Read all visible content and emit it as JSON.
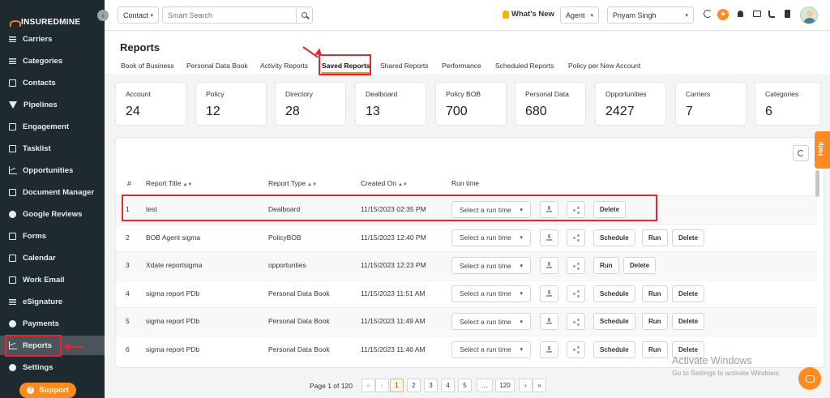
{
  "brand": {
    "name": "INSUREDMINE",
    "accent": "#ff8a1f",
    "highlight": "#e3262f"
  },
  "sidebar": {
    "items": [
      {
        "label": "Carriers",
        "icon": "carrier-icon"
      },
      {
        "label": "Categories",
        "icon": "list-icon"
      },
      {
        "label": "Contacts",
        "icon": "contacts-icon"
      },
      {
        "label": "Pipelines",
        "icon": "filter-icon"
      },
      {
        "label": "Engagement",
        "icon": "megaphone-icon"
      },
      {
        "label": "Tasklist",
        "icon": "tasklist-icon"
      },
      {
        "label": "Opportunities",
        "icon": "bar-chart-icon"
      },
      {
        "label": "Document Manager",
        "icon": "folder-icon"
      },
      {
        "label": "Google Reviews",
        "icon": "google-icon"
      },
      {
        "label": "Forms",
        "icon": "forms-icon"
      },
      {
        "label": "Calendar",
        "icon": "calendar-icon"
      },
      {
        "label": "Work Email",
        "icon": "email-icon"
      },
      {
        "label": "eSignature",
        "icon": "signature-icon"
      },
      {
        "label": "Payments",
        "icon": "dollar-icon"
      },
      {
        "label": "Reports",
        "icon": "line-chart-icon",
        "active": true
      },
      {
        "label": "Settings",
        "icon": "gear-icon"
      }
    ],
    "support_label": "Support"
  },
  "topbar": {
    "search_scope": "Contact",
    "search_placeholder": "Smart Search",
    "whats_new": "What's New",
    "role": "Agent",
    "user": "Priyam Singh"
  },
  "page": {
    "title": "Reports",
    "tabs": [
      {
        "label": "Book of Business"
      },
      {
        "label": "Personal Data Book"
      },
      {
        "label": "Activity Reports"
      },
      {
        "label": "Saved Reports",
        "active": true
      },
      {
        "label": "Shared Reports"
      },
      {
        "label": "Performance"
      },
      {
        "label": "Scheduled Reports"
      },
      {
        "label": "Policy per New Account"
      }
    ]
  },
  "stats": [
    {
      "label": "Account",
      "value": "24"
    },
    {
      "label": "Policy",
      "value": "12"
    },
    {
      "label": "Directory",
      "value": "28"
    },
    {
      "label": "Dealboard",
      "value": "13"
    },
    {
      "label": "Policy BOB",
      "value": "700"
    },
    {
      "label": "Personal Data",
      "value": "680"
    },
    {
      "label": "Opportunities",
      "value": "2427"
    },
    {
      "label": "Carriers",
      "value": "7"
    },
    {
      "label": "Categories",
      "value": "6"
    }
  ],
  "table": {
    "headers": {
      "num": "#",
      "title": "Report Title",
      "type": "Report Type",
      "created": "Created On",
      "run": "Run time"
    },
    "run_placeholder": "Select a run time",
    "rows": [
      {
        "num": "1",
        "title": "test",
        "type": "Dealboard",
        "created": "11/15/2023 02:35 PM",
        "actions": [
          "Delete"
        ]
      },
      {
        "num": "2",
        "title": "BOB Agent sigma",
        "type": "PolicyBOB",
        "created": "11/15/2023 12:40 PM",
        "actions": [
          "Schedule",
          "Run",
          "Delete"
        ]
      },
      {
        "num": "3",
        "title": "Xdate reportsigma",
        "type": "opportunties",
        "created": "11/15/2023 12:23 PM",
        "actions": [
          "Run",
          "Delete"
        ]
      },
      {
        "num": "4",
        "title": "sigma report PDb",
        "type": "Personal Data Book",
        "created": "11/15/2023 11:51 AM",
        "actions": [
          "Schedule",
          "Run",
          "Delete"
        ]
      },
      {
        "num": "5",
        "title": "sigma report PDb",
        "type": "Personal Data Book",
        "created": "11/15/2023 11:49 AM",
        "actions": [
          "Schedule",
          "Run",
          "Delete"
        ]
      },
      {
        "num": "6",
        "title": "sigma report PDb",
        "type": "Personal Data Book",
        "created": "11/15/2023 11:46 AM",
        "actions": [
          "Schedule",
          "Run",
          "Delete"
        ]
      }
    ]
  },
  "pagination": {
    "label": "Page 1 of 120",
    "pages": [
      "«",
      "‹",
      "1",
      "2",
      "3",
      "4",
      "5",
      "...",
      "120",
      "›",
      "»"
    ],
    "current": "1"
  },
  "help_label": "Help",
  "watermark": {
    "title": "Activate Windows",
    "subtitle": "Go to Settings to activate Windows."
  }
}
